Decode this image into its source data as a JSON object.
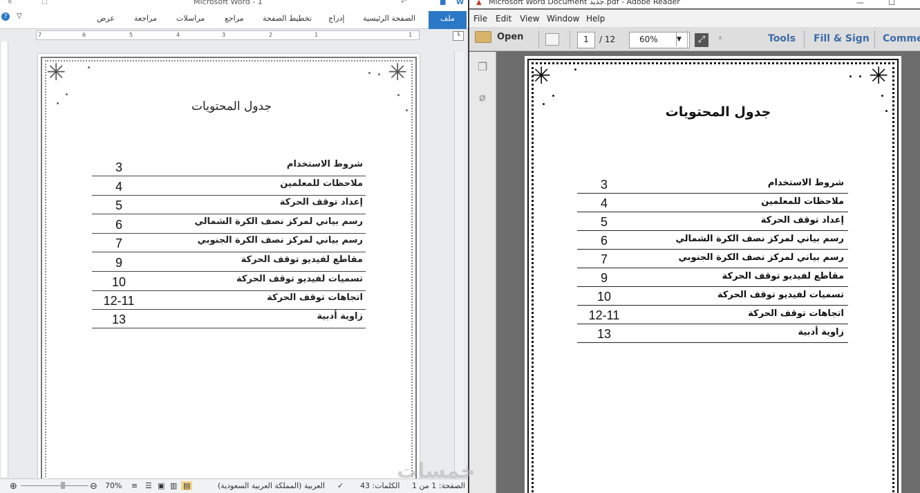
{
  "word": {
    "title": "Microsoft Word - 1",
    "tabs": [
      "ملف",
      "الصفحة الرئيسية",
      "إدراج",
      "تخطيط الصفحة",
      "مراجع",
      "مراسلات",
      "مراجعة",
      "عرض"
    ],
    "ruler_numbers": [
      "7",
      "6",
      "5",
      "4",
      "3",
      "2",
      "1",
      "1"
    ],
    "heading": "جدول المحتويات",
    "toc": [
      {
        "label": "شروط الاستخدام",
        "page": "3"
      },
      {
        "label": "ملاحظات للمعلمين",
        "page": "4"
      },
      {
        "label": "إعداد توقف الحركة",
        "page": "5"
      },
      {
        "label": "رسم بياني لمركز نصف الكرة الشمالي",
        "page": "6"
      },
      {
        "label": "رسم بياني لمركز نصف الكرة الجنوبي",
        "page": "7"
      },
      {
        "label": "مقاطع لفيديو توقف الحركة",
        "page": "9"
      },
      {
        "label": "تسميات لفيديو توقف الحركة",
        "page": "10"
      },
      {
        "label": "اتجاهات توقف الحركة",
        "page": "12-11"
      },
      {
        "label": "زاوية أدبية",
        "page": "13"
      }
    ],
    "status": {
      "page": "الصفحة: 1 من 1",
      "words": "الكلمات: 43",
      "language": "العربية (المملكة العربية السعودية)",
      "zoom": "70%"
    }
  },
  "adobe": {
    "title": "Microsoft Word Document جديد.pdf - Adobe Reader",
    "menu": [
      "File",
      "Edit",
      "View",
      "Window",
      "Help"
    ],
    "toolbar": {
      "open_label": "Open",
      "page_current": "1",
      "page_total": "/ 12",
      "zoom": "60%",
      "tools_label": "Tools",
      "fill_sign_label": "Fill & Sign",
      "comment_label": "Commen"
    },
    "heading": "جدول المحتويات",
    "toc": [
      {
        "label": "شروط الاستخدام",
        "page": "3"
      },
      {
        "label": "ملاحظات للمعلمين",
        "page": "4"
      },
      {
        "label": "إعداد توقف الحركة",
        "page": "5"
      },
      {
        "label": "رسم بياني لمركز نصف الكرة الشمالي",
        "page": "6"
      },
      {
        "label": "رسم بياني لمركز نصف الكرة الجنوبي",
        "page": "7"
      },
      {
        "label": "مقاطع لفيديو توقف الحركة",
        "page": "9"
      },
      {
        "label": "تسميات لفيديو توقف الحركة",
        "page": "10"
      },
      {
        "label": "اتجاهات توقف الحركة",
        "page": "12-11"
      },
      {
        "label": "زاوية أدبية",
        "page": "13"
      }
    ]
  },
  "watermark": "خمسات"
}
